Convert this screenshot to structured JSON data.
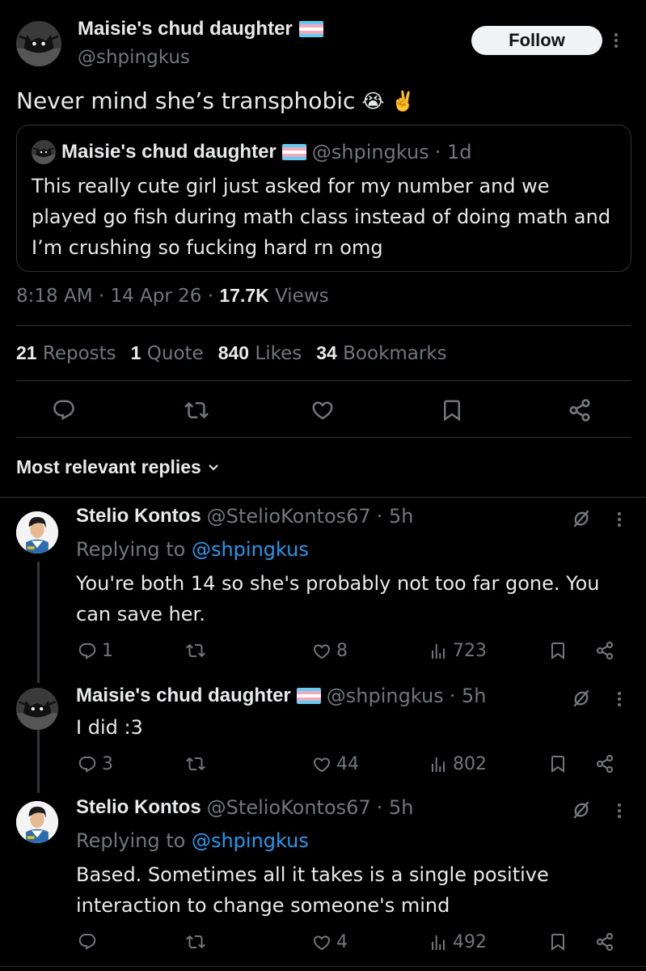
{
  "main_tweet": {
    "author_name": "Maisie's chud daughter",
    "flag_icon": "trans-flag-emoji",
    "author_handle": "@shpingkus",
    "follow_label": "Follow",
    "text": "Never mind she’s transphobic",
    "emojis": [
      "😭",
      "✌️"
    ],
    "quote": {
      "author_name": "Maisie's chud daughter",
      "author_handle": "@shpingkus",
      "age": "· 1d",
      "text": "This really cute girl just asked for my number and we played go fish during math class instead of doing math and I’m crushing so fucking hard rn omg"
    },
    "time": "8:18 AM",
    "date": "14 Apr 26",
    "views_count": "17.7K",
    "views_label": "Views",
    "stats": {
      "reposts_count": "21",
      "reposts_label": "Reposts",
      "quotes_count": "1",
      "quotes_label": "Quote",
      "likes_count": "840",
      "likes_label": "Likes",
      "bookmarks_count": "34",
      "bookmarks_label": "Bookmarks"
    }
  },
  "sort_label": "Most relevant replies",
  "replies": [
    {
      "author_name": "Stelio Kontos",
      "author_handle": "@StelioKontos67",
      "age": "· 5h",
      "replying_prefix": "Replying to",
      "replying_to": "@shpingkus",
      "text": "You're both 14 so she's probably not too far gone. You can save her.",
      "replies_count": "1",
      "reposts_count": "",
      "likes_count": "8",
      "views_count": "723"
    },
    {
      "author_name": "Maisie's chud daughter",
      "author_handle": "@shpingkus",
      "age": "· 5h",
      "text": "I did :3",
      "replies_count": "3",
      "reposts_count": "",
      "likes_count": "44",
      "views_count": "802"
    },
    {
      "author_name": "Stelio Kontos",
      "author_handle": "@StelioKontos67",
      "age": "· 5h",
      "replying_prefix": "Replying to",
      "replying_to": "@shpingkus",
      "text": "Based. Sometimes all it takes is a single positive interaction to change someone's mind",
      "replies_count": "",
      "reposts_count": "",
      "likes_count": "4",
      "views_count": "492"
    }
  ],
  "colors": {
    "background": "#000000",
    "text": "#e7e9ea",
    "muted": "#71767b",
    "link": "#1d9bf0",
    "border": "#2f3336"
  }
}
